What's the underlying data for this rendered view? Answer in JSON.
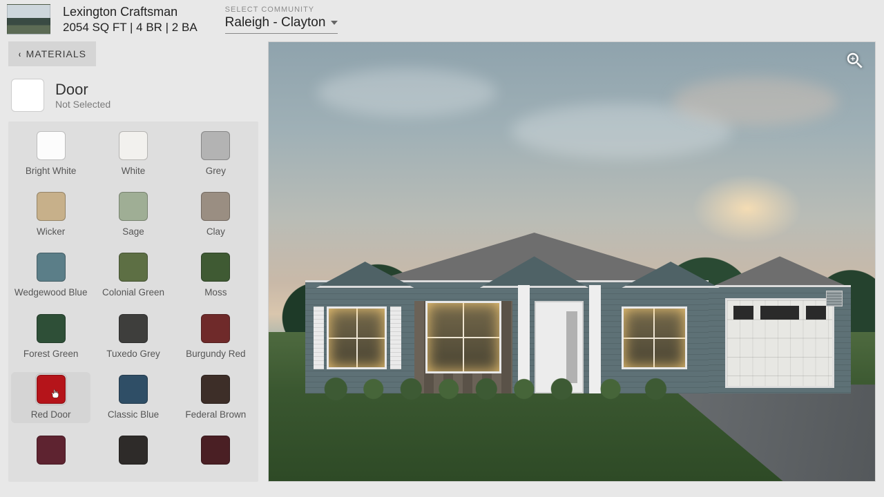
{
  "header": {
    "plan_name": "Lexington Craftsman",
    "plan_specs": "2054 SQ FT | 4 BR | 2 BA",
    "community_label": "SELECT COMMUNITY",
    "community_value": "Raleigh - Clayton"
  },
  "sidebar": {
    "back_label": "MATERIALS",
    "category_title": "Door",
    "category_subtitle": "Not Selected",
    "swatches": [
      {
        "label": "Bright White",
        "color": "#fcfcfc"
      },
      {
        "label": "White",
        "color": "#f2f1ee"
      },
      {
        "label": "Grey",
        "color": "#b3b3b3"
      },
      {
        "label": "Wicker",
        "color": "#c7b08a"
      },
      {
        "label": "Sage",
        "color": "#9fae95"
      },
      {
        "label": "Clay",
        "color": "#9a8e82"
      },
      {
        "label": "Wedgewood Blue",
        "color": "#5b7e88"
      },
      {
        "label": "Colonial Green",
        "color": "#5d6f44"
      },
      {
        "label": "Moss",
        "color": "#3f5a33"
      },
      {
        "label": "Forest Green",
        "color": "#2e4f37"
      },
      {
        "label": "Tuxedo Grey",
        "color": "#3e3e3c"
      },
      {
        "label": "Burgundy Red",
        "color": "#6f2a2a"
      },
      {
        "label": "Red Door",
        "color": "#b5141a",
        "hover": true
      },
      {
        "label": "Classic Blue",
        "color": "#2f4e66"
      },
      {
        "label": "Federal Brown",
        "color": "#3d2e28"
      },
      {
        "label": "",
        "color": "#5e2330"
      },
      {
        "label": "",
        "color": "#2e2b29"
      },
      {
        "label": "",
        "color": "#4a1f24"
      }
    ]
  },
  "viewer": {
    "zoom_label": "Zoom"
  }
}
